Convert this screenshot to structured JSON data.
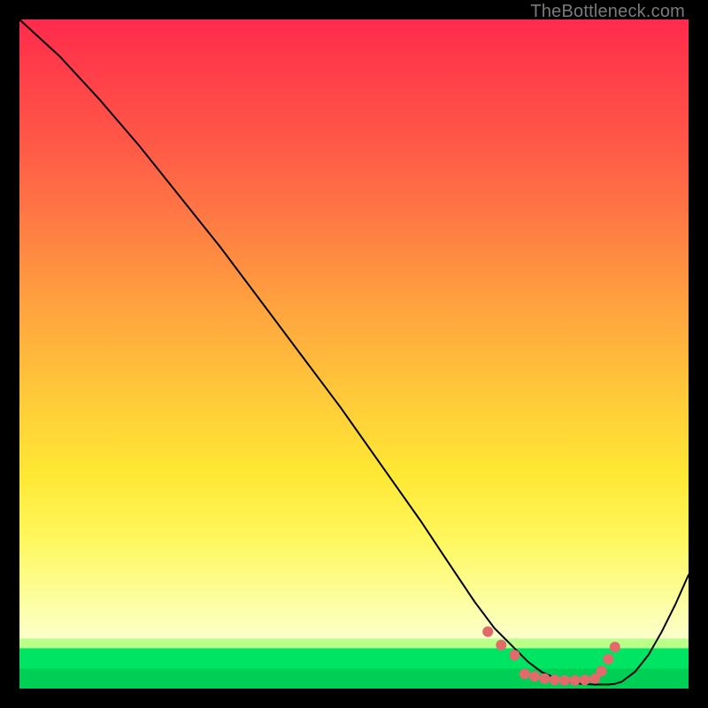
{
  "watermark": "TheBottleneck.com",
  "chart_data": {
    "type": "line",
    "title": "",
    "xlabel": "",
    "ylabel": "",
    "xlim": [
      0,
      100
    ],
    "ylim": [
      0,
      100
    ],
    "grid": false,
    "series": [
      {
        "name": "curve",
        "x": [
          0,
          6,
          12,
          18,
          24,
          30,
          36,
          42,
          48,
          54,
          60,
          64,
          68,
          71,
          74,
          76,
          78,
          80,
          82,
          84,
          86,
          88,
          89,
          90,
          92,
          94,
          96,
          98,
          100
        ],
        "y": [
          100,
          94.5,
          88,
          81,
          73.5,
          66,
          58,
          50,
          42,
          33.5,
          25,
          19,
          13,
          9,
          6,
          4,
          2.5,
          1.6,
          1.0,
          0.7,
          0.6,
          0.6,
          0.7,
          1.0,
          2.5,
          5,
          8.5,
          12.5,
          17
        ],
        "color": "#000000",
        "width": 2
      }
    ],
    "markers": {
      "name": "highlight-dots",
      "color": "#e36a6a",
      "radius": 6,
      "points": [
        {
          "x": 70,
          "y": 8.5
        },
        {
          "x": 72,
          "y": 6.5
        },
        {
          "x": 74,
          "y": 5.0
        },
        {
          "x": 75.5,
          "y": 2.2
        },
        {
          "x": 77,
          "y": 1.8
        },
        {
          "x": 78.5,
          "y": 1.5
        },
        {
          "x": 80,
          "y": 1.3
        },
        {
          "x": 81.5,
          "y": 1.2
        },
        {
          "x": 83,
          "y": 1.2
        },
        {
          "x": 84.5,
          "y": 1.3
        },
        {
          "x": 86,
          "y": 1.5
        },
        {
          "x": 87,
          "y": 2.6
        },
        {
          "x": 88,
          "y": 4.4
        },
        {
          "x": 89,
          "y": 6.2
        }
      ]
    }
  }
}
